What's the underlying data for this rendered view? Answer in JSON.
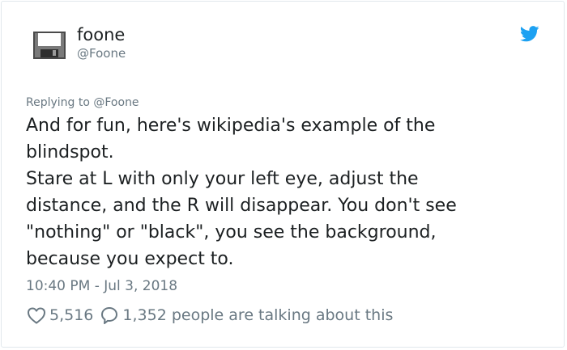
{
  "tweet": {
    "display_name": "foone",
    "handle": "@Foone",
    "replying_to": "Replying to @Foone",
    "body": "And for fun, here's wikipedia's example of the\nblindspot.\nStare at L with only your left eye, adjust the\ndistance, and the R will disappear. You don't see\n\"nothing\" or \"black\", you see the background,\nbecause you expect to.",
    "timestamp": "10:40 PM - Jul 3, 2018",
    "likes": "5,516",
    "talking": "1,352 people are talking about this"
  },
  "icons": {
    "avatar": "floppy-disk-icon",
    "brand": "twitter-bird-icon",
    "like": "heart-icon",
    "reply": "speech-bubble-icon"
  },
  "colors": {
    "brand_blue": "#1da1f2",
    "secondary_text": "#697882",
    "primary_text": "#1c2022",
    "border": "#e1e8ed"
  }
}
